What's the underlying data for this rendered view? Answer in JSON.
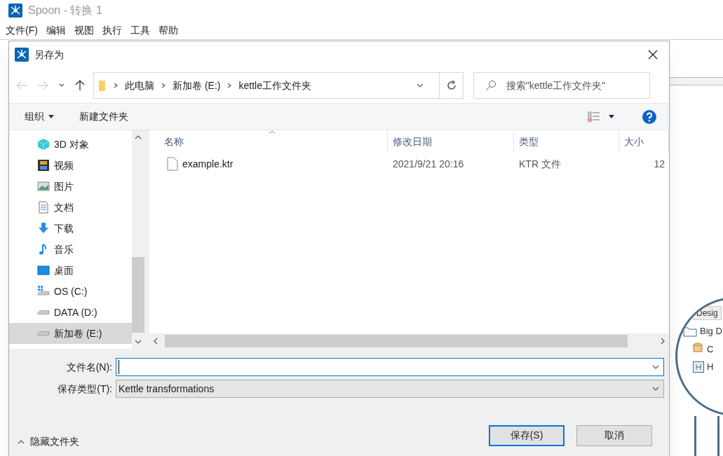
{
  "app": {
    "title": "Spoon - 转换 1",
    "menu": [
      "文件(F)",
      "编辑",
      "视图",
      "执行",
      "工具",
      "帮助"
    ]
  },
  "dialog": {
    "title": "另存为",
    "breadcrumb": [
      "此电脑",
      "新加卷 (E:)",
      "kettle工作文件夹"
    ],
    "search": {
      "placeholder": "搜索\"kettle工作文件夹\""
    },
    "toolbar": {
      "organize": "组织",
      "new_folder": "新建文件夹"
    },
    "nav_items": [
      {
        "label": "3D 对象",
        "kind": "cube",
        "selected": false
      },
      {
        "label": "视频",
        "kind": "video",
        "selected": false
      },
      {
        "label": "图片",
        "kind": "image",
        "selected": false
      },
      {
        "label": "文档",
        "kind": "doc",
        "selected": false
      },
      {
        "label": "下载",
        "kind": "download",
        "selected": false
      },
      {
        "label": "音乐",
        "kind": "music",
        "selected": false
      },
      {
        "label": "桌面",
        "kind": "desktop",
        "selected": false
      },
      {
        "label": "OS (C:)",
        "kind": "osdrive",
        "selected": false
      },
      {
        "label": "DATA (D:)",
        "kind": "drive",
        "selected": false
      },
      {
        "label": "新加卷 (E:)",
        "kind": "drive",
        "selected": true
      }
    ],
    "columns": [
      "名称",
      "修改日期",
      "类型",
      "大小"
    ],
    "files": [
      {
        "name": "example.ktr",
        "modified": "2021/9/21 20:16",
        "type": "KTR 文件",
        "size": "12"
      }
    ],
    "filename": {
      "label": "文件名(N):"
    },
    "filetype": {
      "label": "保存类型(T):",
      "value": "Kettle transformations"
    },
    "hide_folders": "隐藏文件夹",
    "buttons": [
      "保存(S)",
      "取消"
    ]
  },
  "background_panel": {
    "tab": "Desig",
    "items": [
      {
        "label": "Big D",
        "kind": "folder"
      },
      {
        "label": "C",
        "kind": "db"
      },
      {
        "label": "H",
        "kind": "h"
      }
    ]
  }
}
